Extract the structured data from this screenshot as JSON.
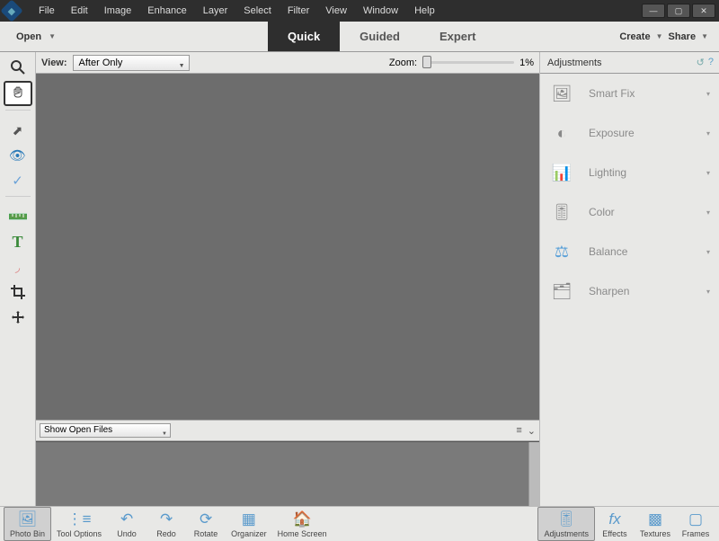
{
  "menubar": [
    "File",
    "Edit",
    "Image",
    "Enhance",
    "Layer",
    "Select",
    "Filter",
    "View",
    "Window",
    "Help"
  ],
  "modebar": {
    "open_label": "Open",
    "tabs": [
      {
        "label": "Quick",
        "active": true
      },
      {
        "label": "Guided",
        "active": false
      },
      {
        "label": "Expert",
        "active": false
      }
    ],
    "create_label": "Create",
    "share_label": "Share"
  },
  "options": {
    "view_label": "View:",
    "view_value": "After Only",
    "zoom_label": "Zoom:",
    "zoom_value": "1%"
  },
  "bin": {
    "select_value": "Show Open Files"
  },
  "right_panel": {
    "title": "Adjustments",
    "items": [
      {
        "label": "Smart Fix"
      },
      {
        "label": "Exposure"
      },
      {
        "label": "Lighting"
      },
      {
        "label": "Color"
      },
      {
        "label": "Balance"
      },
      {
        "label": "Sharpen"
      }
    ]
  },
  "bottom": {
    "left": [
      {
        "label": "Photo Bin",
        "key": "photo-bin"
      },
      {
        "label": "Tool Options",
        "key": "tool-options"
      },
      {
        "label": "Undo",
        "key": "undo"
      },
      {
        "label": "Redo",
        "key": "redo"
      },
      {
        "label": "Rotate",
        "key": "rotate"
      },
      {
        "label": "Organizer",
        "key": "organizer"
      },
      {
        "label": "Home Screen",
        "key": "home-screen"
      }
    ],
    "right": [
      {
        "label": "Adjustments",
        "key": "adjustments"
      },
      {
        "label": "Effects",
        "key": "effects"
      },
      {
        "label": "Textures",
        "key": "textures"
      },
      {
        "label": "Frames",
        "key": "frames"
      }
    ]
  }
}
